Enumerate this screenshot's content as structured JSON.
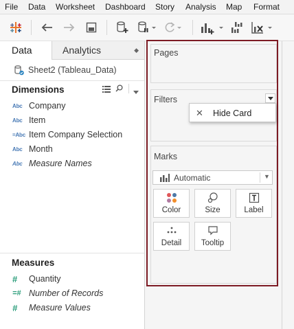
{
  "menu": [
    "File",
    "Data",
    "Worksheet",
    "Dashboard",
    "Story",
    "Analysis",
    "Map",
    "Format"
  ],
  "toolbar": {
    "icons": [
      "tableau-logo-icon",
      "undo-icon",
      "redo-icon",
      "save-icon",
      "new-data-source-icon",
      "pause-updates-icon",
      "refresh-icon",
      "new-worksheet-icon",
      "duplicate-sheet-icon",
      "clear-sheet-icon"
    ]
  },
  "left": {
    "tabs": {
      "data": "Data",
      "analytics": "Analytics"
    },
    "datasource": "Sheet2 (Tableau_Data)",
    "dimensions_title": "Dimensions",
    "dimensions": [
      {
        "type": "Abc",
        "name": "Company",
        "italic": false
      },
      {
        "type": "Abc",
        "name": "Item",
        "italic": false
      },
      {
        "type": "=Abc",
        "name": "Item Company Selection",
        "italic": false
      },
      {
        "type": "Abc",
        "name": "Month",
        "italic": false
      },
      {
        "type": "Abc",
        "name": "Measure Names",
        "italic": true
      }
    ],
    "measures_title": "Measures",
    "measures": [
      {
        "type": "#",
        "name": "Quantity",
        "italic": false
      },
      {
        "type": "=#",
        "name": "Number of Records",
        "italic": true
      },
      {
        "type": "#",
        "name": "Measure Values",
        "italic": true
      }
    ]
  },
  "cards": {
    "pages": "Pages",
    "filters": "Filters",
    "context_menu": {
      "close": "✕",
      "item": "Hide Card"
    },
    "marks": "Marks",
    "mark_type": "Automatic",
    "mark_buttons": [
      "Color",
      "Size",
      "Label",
      "Detail",
      "Tooltip"
    ]
  },
  "colors": {
    "highlight_border": "#7d1b24",
    "dimension_icon": "#4a7bb6",
    "measure_icon": "#2a9d7a"
  }
}
